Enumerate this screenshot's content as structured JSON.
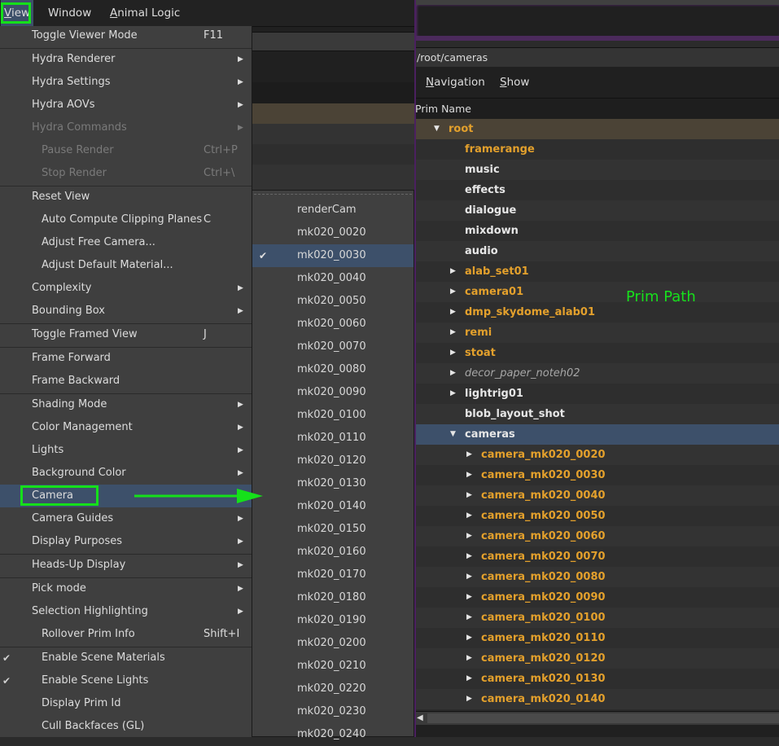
{
  "menubar": {
    "items": [
      {
        "label": "View",
        "mnemonic": "V",
        "active": true
      },
      {
        "label": "Window",
        "mnemonic": ""
      },
      {
        "label": "Animal Logic",
        "mnemonic": "A"
      }
    ]
  },
  "view_menu": {
    "items": [
      {
        "label": "Toggle Viewer Mode",
        "shortcut": "F11",
        "submenu": false,
        "indent": false
      },
      {
        "separator": true
      },
      {
        "label": "Hydra Renderer",
        "submenu": true,
        "indent": false
      },
      {
        "label": "Hydra Settings",
        "submenu": true,
        "indent": false
      },
      {
        "label": "Hydra AOVs",
        "submenu": true,
        "indent": false
      },
      {
        "label": "Hydra Commands",
        "submenu": true,
        "indent": false,
        "disabled": true
      },
      {
        "label": "Pause Render",
        "shortcut": "Ctrl+P",
        "indent": true,
        "disabled": true
      },
      {
        "label": "Stop Render",
        "shortcut": "Ctrl+\\",
        "indent": true,
        "disabled": true
      },
      {
        "separator": true
      },
      {
        "label": "Reset View",
        "indent": false
      },
      {
        "label": "Auto Compute Clipping Planes",
        "shortcut": "C",
        "indent": true
      },
      {
        "label": "Adjust Free Camera...",
        "indent": true
      },
      {
        "label": "Adjust Default Material...",
        "indent": true
      },
      {
        "label": "Complexity",
        "submenu": true,
        "indent": false
      },
      {
        "label": "Bounding Box",
        "submenu": true,
        "indent": false
      },
      {
        "separator": true
      },
      {
        "label": "Toggle Framed View",
        "shortcut": "J",
        "indent": false
      },
      {
        "separator": true
      },
      {
        "label": "Frame Forward",
        "indent": false
      },
      {
        "label": "Frame Backward",
        "indent": false
      },
      {
        "separator": true
      },
      {
        "label": "Shading Mode",
        "submenu": true,
        "indent": false
      },
      {
        "label": "Color Management",
        "submenu": true,
        "indent": false
      },
      {
        "label": "Lights",
        "submenu": true,
        "indent": false
      },
      {
        "label": "Background Color",
        "submenu": true,
        "indent": false
      },
      {
        "label": "Camera",
        "submenu": true,
        "indent": false,
        "highlighted": true
      },
      {
        "label": "Camera Guides",
        "submenu": true,
        "indent": false
      },
      {
        "label": "Display Purposes",
        "submenu": true,
        "indent": false
      },
      {
        "separator": true
      },
      {
        "label": "Heads-Up Display",
        "submenu": true,
        "indent": false
      },
      {
        "separator": true
      },
      {
        "label": "Pick mode",
        "submenu": true,
        "indent": false
      },
      {
        "label": "Selection Highlighting",
        "submenu": true,
        "indent": false
      },
      {
        "label": "Rollover Prim Info",
        "shortcut": "Shift+I",
        "indent": true
      },
      {
        "separator": true
      },
      {
        "label": "Enable Scene Materials",
        "indent": true,
        "checked": true
      },
      {
        "label": "Enable Scene Lights",
        "indent": true,
        "checked": true
      },
      {
        "label": "Display Prim Id",
        "indent": true
      },
      {
        "label": "Cull Backfaces (GL)",
        "indent": true
      }
    ]
  },
  "camera_submenu": {
    "items": [
      {
        "label": "renderCam"
      },
      {
        "label": "mk020_0020"
      },
      {
        "label": "mk020_0030",
        "checked": true
      },
      {
        "label": "mk020_0040"
      },
      {
        "label": "mk020_0050"
      },
      {
        "label": "mk020_0060"
      },
      {
        "label": "mk020_0070"
      },
      {
        "label": "mk020_0080"
      },
      {
        "label": "mk020_0090"
      },
      {
        "label": "mk020_0100"
      },
      {
        "label": "mk020_0110"
      },
      {
        "label": "mk020_0120"
      },
      {
        "label": "mk020_0130"
      },
      {
        "label": "mk020_0140"
      },
      {
        "label": "mk020_0150"
      },
      {
        "label": "mk020_0160"
      },
      {
        "label": "mk020_0170"
      },
      {
        "label": "mk020_0180"
      },
      {
        "label": "mk020_0190"
      },
      {
        "label": "mk020_0200"
      },
      {
        "label": "mk020_0210"
      },
      {
        "label": "mk020_0220"
      },
      {
        "label": "mk020_0230"
      },
      {
        "label": "mk020_0240"
      }
    ]
  },
  "prim_browser": {
    "path": "/root/cameras",
    "nav_menu": [
      {
        "label": "Navigation",
        "mnemonic": "N"
      },
      {
        "label": "Show",
        "mnemonic": "S"
      }
    ],
    "column_header": "Prim Name",
    "annotation": "Prim Path",
    "rows": [
      {
        "name": "root",
        "depth": 0,
        "expander": "expanded",
        "style": "orange",
        "root": true
      },
      {
        "name": "framerange",
        "depth": 1,
        "expander": "none",
        "style": "orange"
      },
      {
        "name": "music",
        "depth": 1,
        "expander": "none",
        "style": "white"
      },
      {
        "name": "effects",
        "depth": 1,
        "expander": "none",
        "style": "white"
      },
      {
        "name": "dialogue",
        "depth": 1,
        "expander": "none",
        "style": "white"
      },
      {
        "name": "mixdown",
        "depth": 1,
        "expander": "none",
        "style": "white"
      },
      {
        "name": "audio",
        "depth": 1,
        "expander": "none",
        "style": "white"
      },
      {
        "name": "alab_set01",
        "depth": 1,
        "expander": "collapsed",
        "style": "orange"
      },
      {
        "name": "camera01",
        "depth": 1,
        "expander": "collapsed",
        "style": "orange"
      },
      {
        "name": "dmp_skydome_alab01",
        "depth": 1,
        "expander": "collapsed",
        "style": "orange"
      },
      {
        "name": "remi",
        "depth": 1,
        "expander": "collapsed",
        "style": "orange"
      },
      {
        "name": "stoat",
        "depth": 1,
        "expander": "collapsed",
        "style": "orange"
      },
      {
        "name": "decor_paper_noteh02",
        "depth": 1,
        "expander": "collapsed",
        "style": "italic"
      },
      {
        "name": "lightrig01",
        "depth": 1,
        "expander": "collapsed",
        "style": "white"
      },
      {
        "name": "blob_layout_shot",
        "depth": 1,
        "expander": "none",
        "style": "white"
      },
      {
        "name": "cameras",
        "depth": 1,
        "expander": "expanded",
        "style": "white",
        "selected": true
      },
      {
        "name": "camera_mk020_0020",
        "depth": 2,
        "expander": "collapsed",
        "style": "orange"
      },
      {
        "name": "camera_mk020_0030",
        "depth": 2,
        "expander": "collapsed",
        "style": "orange"
      },
      {
        "name": "camera_mk020_0040",
        "depth": 2,
        "expander": "collapsed",
        "style": "orange"
      },
      {
        "name": "camera_mk020_0050",
        "depth": 2,
        "expander": "collapsed",
        "style": "orange"
      },
      {
        "name": "camera_mk020_0060",
        "depth": 2,
        "expander": "collapsed",
        "style": "orange"
      },
      {
        "name": "camera_mk020_0070",
        "depth": 2,
        "expander": "collapsed",
        "style": "orange"
      },
      {
        "name": "camera_mk020_0080",
        "depth": 2,
        "expander": "collapsed",
        "style": "orange"
      },
      {
        "name": "camera_mk020_0090",
        "depth": 2,
        "expander": "collapsed",
        "style": "orange"
      },
      {
        "name": "camera_mk020_0100",
        "depth": 2,
        "expander": "collapsed",
        "style": "orange"
      },
      {
        "name": "camera_mk020_0110",
        "depth": 2,
        "expander": "collapsed",
        "style": "orange"
      },
      {
        "name": "camera_mk020_0120",
        "depth": 2,
        "expander": "collapsed",
        "style": "orange"
      },
      {
        "name": "camera_mk020_0130",
        "depth": 2,
        "expander": "collapsed",
        "style": "orange"
      },
      {
        "name": "camera_mk020_0140",
        "depth": 2,
        "expander": "collapsed",
        "style": "orange"
      }
    ]
  },
  "icons": {
    "submenu_arrow": "▶",
    "check": "✔",
    "tree_expanded": "▼",
    "tree_collapsed": "▶",
    "scroll_left": "◀"
  },
  "colors": {
    "highlight": "#3d506a",
    "annotation_green": "#15e01a",
    "prim_orange": "#e3a02c"
  }
}
